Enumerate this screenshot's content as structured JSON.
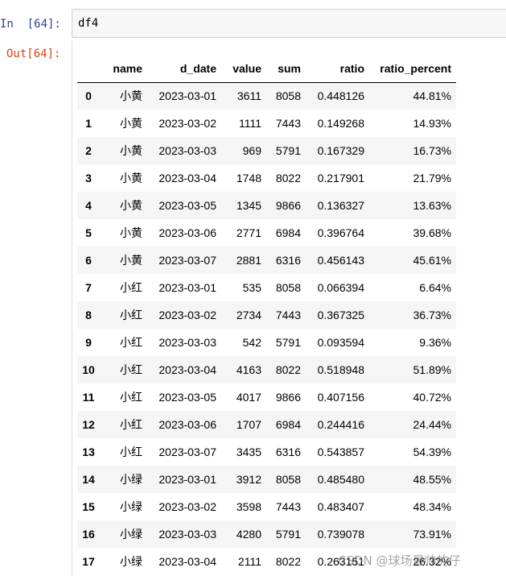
{
  "cell": {
    "in_prompt": "In  [64]:",
    "code": "df4",
    "out_prompt": "Out[64]:"
  },
  "table": {
    "columns": [
      "",
      "name",
      "d_date",
      "value",
      "sum",
      "ratio",
      "ratio_percent"
    ],
    "rows": [
      {
        "index": "0",
        "name": "小黄",
        "d_date": "2023-03-01",
        "value": "3611",
        "sum": "8058",
        "ratio": "0.448126",
        "ratio_percent": "44.81%"
      },
      {
        "index": "1",
        "name": "小黄",
        "d_date": "2023-03-02",
        "value": "1111",
        "sum": "7443",
        "ratio": "0.149268",
        "ratio_percent": "14.93%"
      },
      {
        "index": "2",
        "name": "小黄",
        "d_date": "2023-03-03",
        "value": "969",
        "sum": "5791",
        "ratio": "0.167329",
        "ratio_percent": "16.73%"
      },
      {
        "index": "3",
        "name": "小黄",
        "d_date": "2023-03-04",
        "value": "1748",
        "sum": "8022",
        "ratio": "0.217901",
        "ratio_percent": "21.79%"
      },
      {
        "index": "4",
        "name": "小黄",
        "d_date": "2023-03-05",
        "value": "1345",
        "sum": "9866",
        "ratio": "0.136327",
        "ratio_percent": "13.63%"
      },
      {
        "index": "5",
        "name": "小黄",
        "d_date": "2023-03-06",
        "value": "2771",
        "sum": "6984",
        "ratio": "0.396764",
        "ratio_percent": "39.68%"
      },
      {
        "index": "6",
        "name": "小黄",
        "d_date": "2023-03-07",
        "value": "2881",
        "sum": "6316",
        "ratio": "0.456143",
        "ratio_percent": "45.61%"
      },
      {
        "index": "7",
        "name": "小红",
        "d_date": "2023-03-01",
        "value": "535",
        "sum": "8058",
        "ratio": "0.066394",
        "ratio_percent": "6.64%"
      },
      {
        "index": "8",
        "name": "小红",
        "d_date": "2023-03-02",
        "value": "2734",
        "sum": "7443",
        "ratio": "0.367325",
        "ratio_percent": "36.73%"
      },
      {
        "index": "9",
        "name": "小红",
        "d_date": "2023-03-03",
        "value": "542",
        "sum": "5791",
        "ratio": "0.093594",
        "ratio_percent": "9.36%"
      },
      {
        "index": "10",
        "name": "小红",
        "d_date": "2023-03-04",
        "value": "4163",
        "sum": "8022",
        "ratio": "0.518948",
        "ratio_percent": "51.89%"
      },
      {
        "index": "11",
        "name": "小红",
        "d_date": "2023-03-05",
        "value": "4017",
        "sum": "9866",
        "ratio": "0.407156",
        "ratio_percent": "40.72%"
      },
      {
        "index": "12",
        "name": "小红",
        "d_date": "2023-03-06",
        "value": "1707",
        "sum": "6984",
        "ratio": "0.244416",
        "ratio_percent": "24.44%"
      },
      {
        "index": "13",
        "name": "小红",
        "d_date": "2023-03-07",
        "value": "3435",
        "sum": "6316",
        "ratio": "0.543857",
        "ratio_percent": "54.39%"
      },
      {
        "index": "14",
        "name": "小绿",
        "d_date": "2023-03-01",
        "value": "3912",
        "sum": "8058",
        "ratio": "0.485480",
        "ratio_percent": "48.55%"
      },
      {
        "index": "15",
        "name": "小绿",
        "d_date": "2023-03-02",
        "value": "3598",
        "sum": "7443",
        "ratio": "0.483407",
        "ratio_percent": "48.34%"
      },
      {
        "index": "16",
        "name": "小绿",
        "d_date": "2023-03-03",
        "value": "4280",
        "sum": "5791",
        "ratio": "0.739078",
        "ratio_percent": "73.91%"
      },
      {
        "index": "17",
        "name": "小绿",
        "d_date": "2023-03-04",
        "value": "2111",
        "sum": "8022",
        "ratio": "0.263151",
        "ratio_percent": "26.32%"
      }
    ]
  },
  "watermark": "CSDN @球场最帅的仔",
  "colors": {
    "in_prompt": "#303f9f",
    "out_prompt": "#d84315",
    "stripe": "#f5f5f5"
  }
}
